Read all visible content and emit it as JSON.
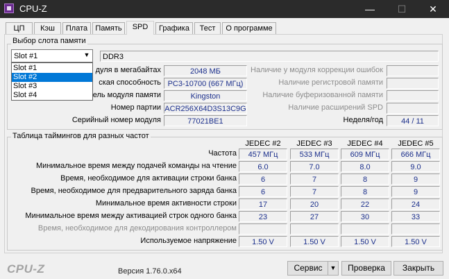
{
  "window": {
    "title": "CPU-Z",
    "minimize": "—",
    "maximize": "☐",
    "close": "✕"
  },
  "tabs": [
    "ЦП",
    "Кэш",
    "Плата",
    "Память",
    "SPD",
    "Графика",
    "Тест",
    "О программе"
  ],
  "slot": {
    "group_title": "Выбор слота памяти",
    "selected": "Slot #1",
    "options": [
      "Slot #1",
      "Slot #2",
      "Slot #3",
      "Slot #4"
    ],
    "highlighted_option": "Slot #2",
    "type": "DDR3",
    "labels": {
      "module_size": "дуля в мегабайтах",
      "bandwidth": "ская способность",
      "manufacturer": "ель модуля памяти",
      "part_number": "Номер партии",
      "serial_number": "Серийный номер модуля"
    },
    "values": {
      "module_size": "2048 МБ",
      "bandwidth": "PC3-10700 (667 МГц)",
      "manufacturer": "Kingston",
      "part_number": "ACR256X64D3S13C9G",
      "serial_number": "77021BE1"
    },
    "right_labels": {
      "ecc": "Наличие у модуля коррекции ошибок",
      "registered": "Наличие регистровой памяти",
      "buffered": "Наличие буферизованной памяти",
      "spd_ext": "Наличие расширений SPD",
      "week_year": "Неделя/год"
    },
    "week_year": "44 / 11"
  },
  "timings": {
    "group_title": "Таблица таймингов для разных частот",
    "columns": [
      "JEDEC #2",
      "JEDEC #3",
      "JEDEC #4",
      "JEDEC #5"
    ],
    "rows": [
      {
        "label": "Частота",
        "values": [
          "457 МГц",
          "533 МГц",
          "609 МГц",
          "666 МГц"
        ],
        "disabled": false
      },
      {
        "label": "Минимальное время между подачей команды на чтение",
        "values": [
          "6.0",
          "7.0",
          "8.0",
          "9.0"
        ],
        "disabled": false
      },
      {
        "label": "Время, необходимое для активации строки банка",
        "values": [
          "6",
          "7",
          "8",
          "9"
        ],
        "disabled": false
      },
      {
        "label": "Время, необходимое для предварительного заряда банка",
        "values": [
          "6",
          "7",
          "8",
          "9"
        ],
        "disabled": false
      },
      {
        "label": "Минимальное время активности строки",
        "values": [
          "17",
          "20",
          "22",
          "24"
        ],
        "disabled": false
      },
      {
        "label": "Минимальное время между активацией строк одного банка",
        "values": [
          "23",
          "27",
          "30",
          "33"
        ],
        "disabled": false
      },
      {
        "label": "Время, необходимое для декодирования контроллером",
        "values": [
          "",
          "",
          "",
          ""
        ],
        "disabled": true
      },
      {
        "label": "Используемое напряжение",
        "values": [
          "1.50 V",
          "1.50 V",
          "1.50 V",
          "1.50 V"
        ],
        "disabled": false
      }
    ]
  },
  "footer": {
    "logo": "CPU-Z",
    "version": "Версия 1.76.0.x64",
    "service": "Сервис",
    "service_arrow": "▼",
    "check": "Проверка",
    "close": "Закрыть"
  }
}
